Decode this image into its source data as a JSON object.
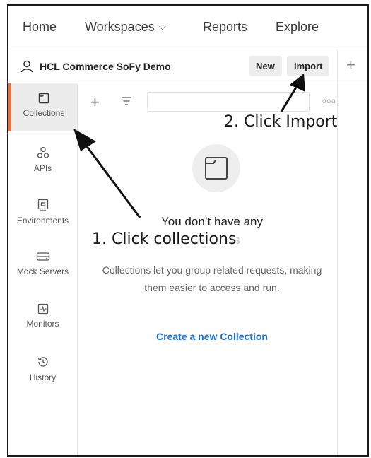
{
  "nav": {
    "home": "Home",
    "workspaces": "Workspaces",
    "reports": "Reports",
    "explore": "Explore"
  },
  "workspace": {
    "name": "HCL Commerce SoFy Demo",
    "new_label": "New",
    "import_label": "Import",
    "add_tab_symbol": "+"
  },
  "sidebar": {
    "items": [
      {
        "label": "Collections",
        "icon": "collections-icon",
        "active": true
      },
      {
        "label": "APIs",
        "icon": "apis-icon",
        "active": false
      },
      {
        "label": "Environments",
        "icon": "environments-icon",
        "active": false
      },
      {
        "label": "Mock Servers",
        "icon": "mock-servers-icon",
        "active": false
      },
      {
        "label": "Monitors",
        "icon": "monitors-icon",
        "active": false
      },
      {
        "label": "History",
        "icon": "history-icon",
        "active": false
      }
    ]
  },
  "toolbar": {
    "add_symbol": "+",
    "more_symbol": "ooo"
  },
  "empty_state": {
    "title": "You don’t have any",
    "title_cont": "collections",
    "description": "Collections let you group related requests, making them easier to access and run.",
    "create_link": "Create a new Collection"
  },
  "annotations": {
    "step1": "1. Click collections",
    "step2": "2. Click Import"
  },
  "colors": {
    "accent": "#f26b3a",
    "link": "#1f75cb",
    "active_bg": "#ececec"
  }
}
